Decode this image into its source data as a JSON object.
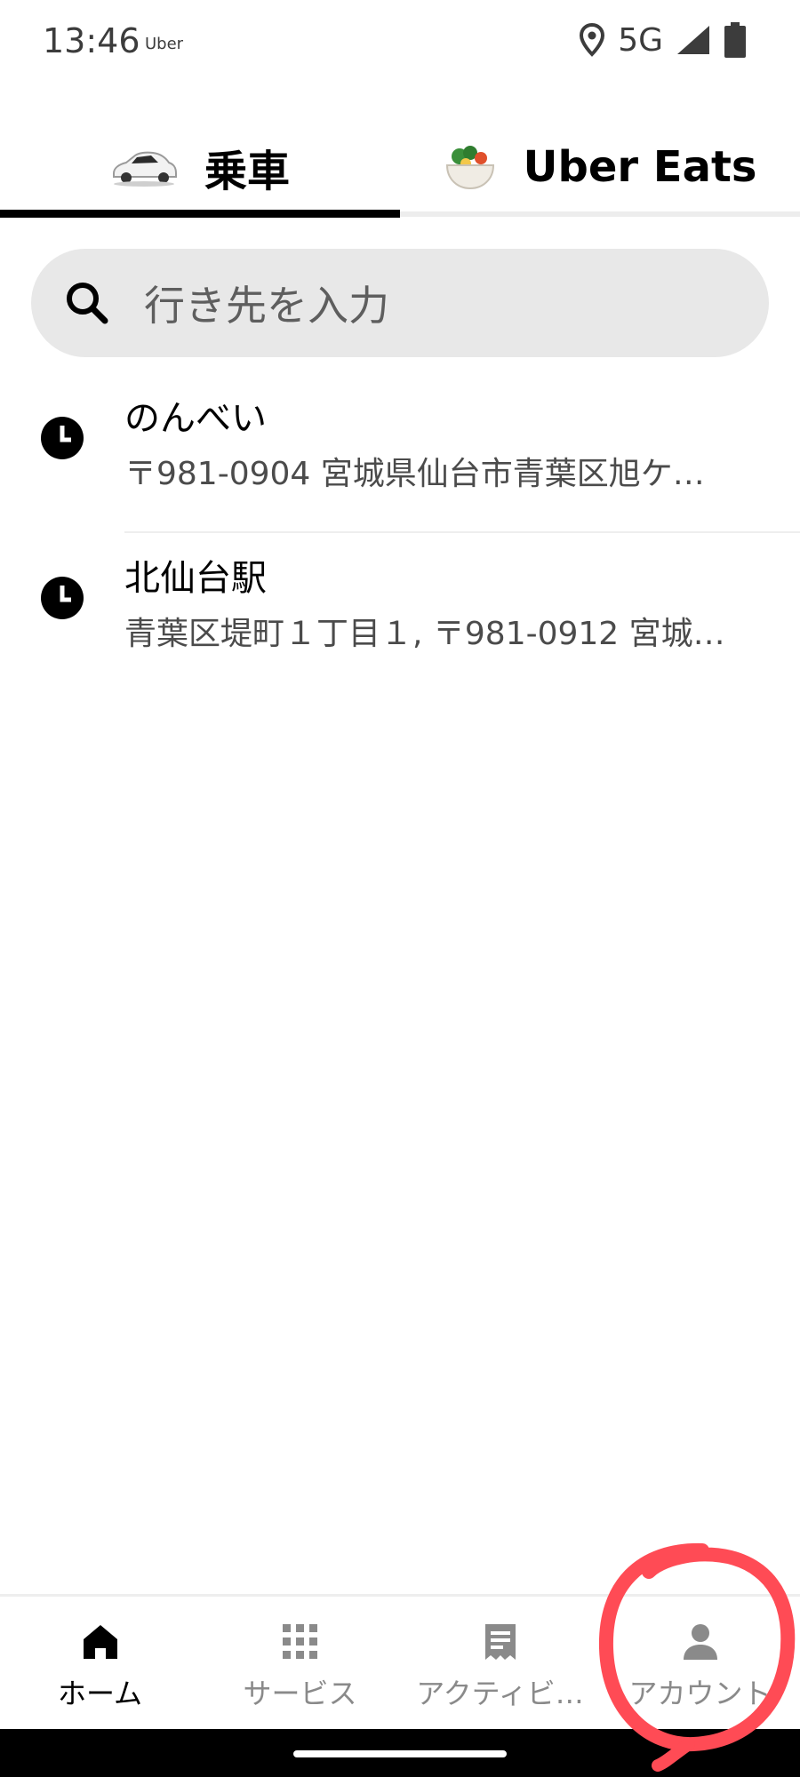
{
  "status_bar": {
    "time": "13:46",
    "app": "Uber",
    "network": "5G"
  },
  "tabs": [
    {
      "label": "乗車",
      "icon": "car-icon",
      "active": true
    },
    {
      "label": "Uber Eats",
      "icon": "food-bowl-icon",
      "active": false
    }
  ],
  "search": {
    "placeholder": "行き先を入力",
    "icon": "search-icon"
  },
  "recent": [
    {
      "title": "のんべい",
      "subtitle": "〒981-0904 宮城県仙台市青葉区旭ケ…"
    },
    {
      "title": "北仙台駅",
      "subtitle": "青葉区堤町１丁目１, 〒981-0912 宮城…"
    }
  ],
  "bottom_nav": [
    {
      "label": "ホーム",
      "icon": "home-icon",
      "active": true
    },
    {
      "label": "サービス",
      "icon": "grid-icon",
      "active": false
    },
    {
      "label": "アクティビ…",
      "icon": "receipt-icon",
      "active": false
    },
    {
      "label": "アカウント",
      "icon": "person-icon",
      "active": false
    }
  ],
  "colors": {
    "annotation": "#ff4b55",
    "search_bg": "#e8e8e8",
    "active": "#000000",
    "inactive": "#8a8a8a"
  }
}
